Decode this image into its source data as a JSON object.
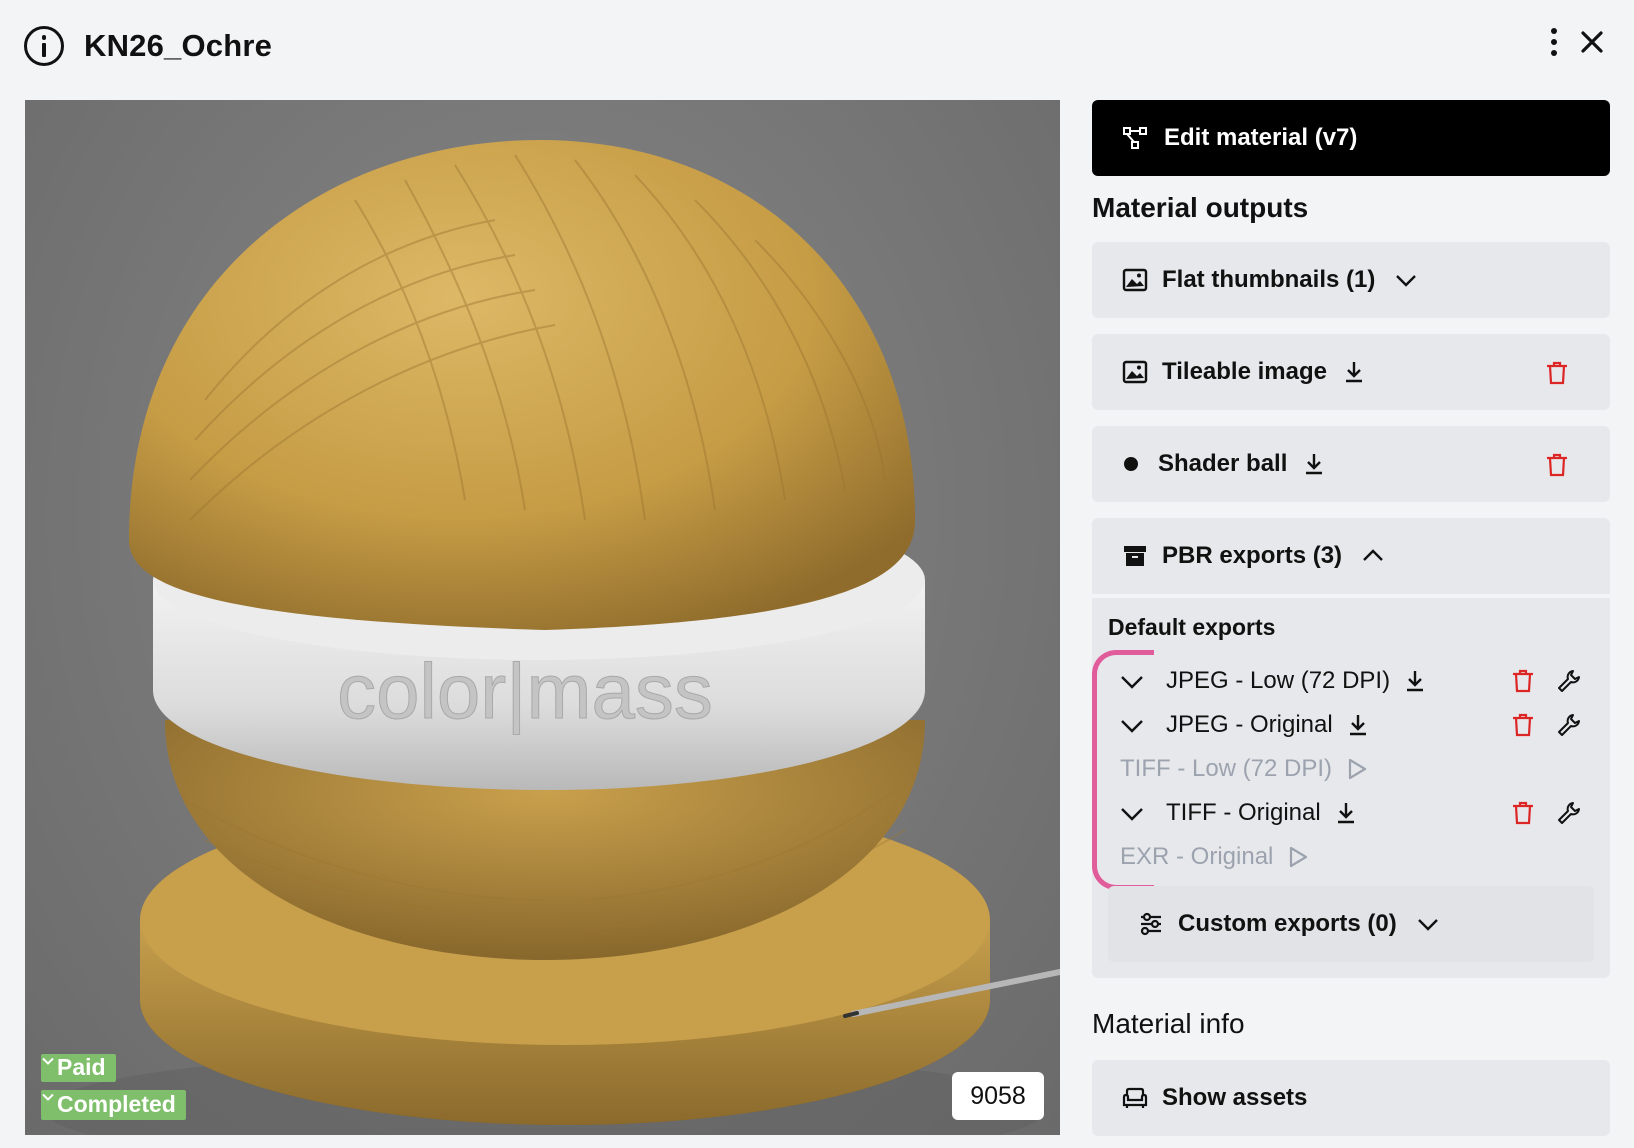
{
  "header": {
    "title": "KN26_Ochre"
  },
  "preview": {
    "badges": {
      "paid": "Paid",
      "completed": "Completed"
    },
    "count": "9058",
    "watermark": "color|mass"
  },
  "panel": {
    "edit_button": "Edit material (v7)",
    "outputs_title": "Material outputs",
    "flat_thumbnails": "Flat thumbnails (1)",
    "tileable_image": "Tileable image",
    "shader_ball": "Shader ball",
    "pbr_exports": "PBR exports (3)",
    "default_exports_title": "Default exports",
    "exports": [
      {
        "label": "JPEG - Low (72 DPI)",
        "enabled": true
      },
      {
        "label": "JPEG - Original",
        "enabled": true
      },
      {
        "label": "TIFF - Low (72 DPI)",
        "enabled": false
      },
      {
        "label": "TIFF - Original",
        "enabled": true
      },
      {
        "label": "EXR - Original",
        "enabled": false
      }
    ],
    "custom_exports": "Custom exports (0)",
    "info_title": "Material info",
    "show_assets": "Show assets"
  },
  "colors": {
    "accent_pink": "#e05c9a",
    "delete_red": "#dc2626",
    "badge_green": "#7fbf6b",
    "ochre": "#c9a24a"
  }
}
